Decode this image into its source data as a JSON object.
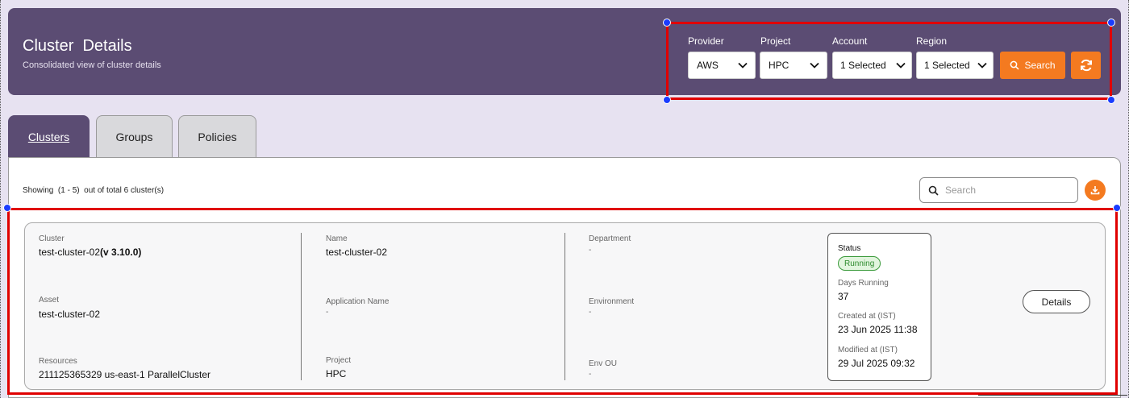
{
  "header": {
    "title": "Cluster  Details",
    "subtitle": "Consolidated view of cluster details"
  },
  "filters": {
    "provider": {
      "label": "Provider",
      "value": "AWS"
    },
    "project": {
      "label": "Project",
      "value": "HPC"
    },
    "account": {
      "label": "Account",
      "value": "1 Selected"
    },
    "region": {
      "label": "Region",
      "value": "1 Selected"
    },
    "search_label": "Search",
    "refresh_icon": "refresh-icon"
  },
  "tabs": [
    {
      "label": "Clusters",
      "active": true
    },
    {
      "label": "Groups",
      "active": false
    },
    {
      "label": "Policies",
      "active": false
    }
  ],
  "list": {
    "showing_text": "Showing  (1 - 5)  out of total 6 cluster(s)",
    "search_placeholder": "Search"
  },
  "cluster_card": {
    "cluster_label": "Cluster",
    "cluster_value": "test-cluster-02",
    "cluster_version": "(v 3.10.0)",
    "asset_label": "Asset",
    "asset_value": "test-cluster-02",
    "resources_label": "Resources",
    "resources_value": "211125365329 us-east-1 ParallelCluster",
    "name_label": "Name",
    "name_value": "test-cluster-02",
    "app_name_label": "Application Name",
    "app_name_value": "-",
    "project_label": "Project",
    "project_value": "HPC",
    "department_label": "Department",
    "department_value": "-",
    "environment_label": "Environment",
    "environment_value": "-",
    "env_ou_label": "Env OU",
    "env_ou_value": "-",
    "status_label": "Status",
    "status_value": "Running",
    "days_running_label": "Days Running",
    "days_running_value": "37",
    "created_label": "Created at (IST)",
    "created_value": "23 Jun 2025 11:38",
    "modified_label": "Modified at (IST)",
    "modified_value": "29 Jul 2025 09:32",
    "details_label": "Details"
  },
  "colors": {
    "header_bg": "#5b4c73",
    "accent_orange": "#f47a20",
    "annotation_red": "#e00000",
    "annotation_blue": "#1a3cff",
    "running_green": "#2c8a2c"
  }
}
